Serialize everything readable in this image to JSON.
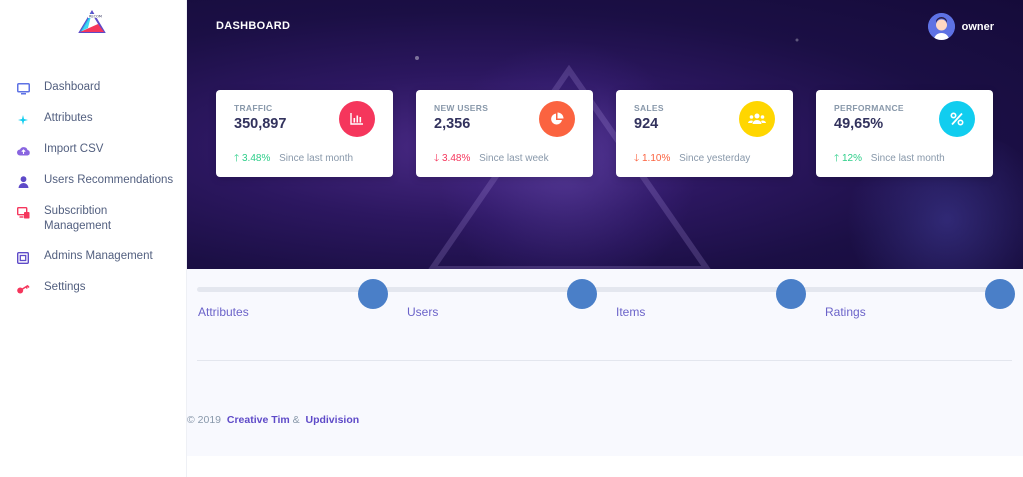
{
  "header": {
    "title": "DASHBOARD",
    "user_name": "owner"
  },
  "sidebar": {
    "items": [
      {
        "label": "Dashboard",
        "icon": "monitor-icon",
        "color": "#5e72e4"
      },
      {
        "label": "Attributes",
        "icon": "sparkle-icon",
        "color": "#11cdef"
      },
      {
        "label": "Import CSV",
        "icon": "cloud-upload-icon",
        "color": "#8965e0"
      },
      {
        "label": "Users Recommendations",
        "icon": "user-icon",
        "color": "#5e4ac8"
      },
      {
        "label": "Subscribtion Management",
        "icon": "devices-icon",
        "color": "#f5365c"
      },
      {
        "label": "Admins Management",
        "icon": "admin-panel-icon",
        "color": "#5e4ac8"
      },
      {
        "label": "Settings",
        "icon": "settings-key-icon",
        "color": "#f5365c"
      }
    ]
  },
  "cards": [
    {
      "title": "TRAFFIC",
      "value": "350,897",
      "change": "3.48%",
      "direction": "up",
      "since": "Since last month",
      "icon": "chart-bar-icon",
      "icon_color": "#f5365c"
    },
    {
      "title": "NEW USERS",
      "value": "2,356",
      "change": "3.48%",
      "direction": "down",
      "since": "Since last week",
      "icon": "chart-pie-icon",
      "icon_color": "#fb6340"
    },
    {
      "title": "SALES",
      "value": "924",
      "change": "1.10%",
      "direction": "down",
      "since": "Since yesterday",
      "icon": "users-icon",
      "icon_color": "#ffd600"
    },
    {
      "title": "PERFORMANCE",
      "value": "49,65%",
      "change": "12%",
      "direction": "up",
      "since": "Since last month",
      "icon": "percent-icon",
      "icon_color": "#11cdef"
    }
  ],
  "stepper": {
    "steps": [
      "Attributes",
      "Users",
      "Items",
      "Ratings"
    ]
  },
  "footer": {
    "copyright": "© 2019",
    "link1": "Creative Tim",
    "amp": "&",
    "link2": "Updivision"
  }
}
